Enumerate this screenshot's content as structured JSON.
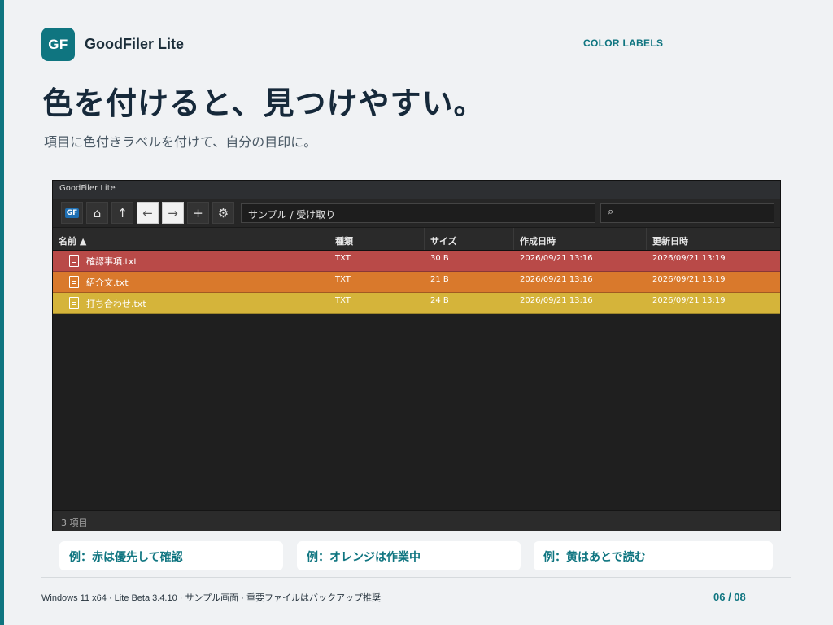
{
  "brand": {
    "logo_text": "GF",
    "name": "GoodFiler Lite"
  },
  "section_tag": "COLOR LABELS",
  "headline": "色を付けると、見つけやすい。",
  "subline": "項目に色付きラベルを付けて、自分の目印に。",
  "app": {
    "title": "GoodFiler Lite",
    "toolbar": {
      "logo_label": "GF",
      "home_glyph": "⌂",
      "up_glyph": "↑",
      "back_glyph": "←",
      "forward_glyph": "→",
      "add_glyph": "+",
      "settings_glyph": "⚙",
      "path": "サンプル / 受け取り",
      "search_glyph": "⌕"
    },
    "columns": [
      "名前 ▲",
      "種類",
      "サイズ",
      "作成日時",
      "更新日時"
    ],
    "rows": [
      {
        "name": "確認事項.txt",
        "type": "TXT",
        "size": "30 B",
        "created": "2026/09/21 13:16",
        "modified": "2026/09/21 13:19",
        "label_color": "#b94a48"
      },
      {
        "name": "紹介文.txt",
        "type": "TXT",
        "size": "21 B",
        "created": "2026/09/21 13:16",
        "modified": "2026/09/21 13:19",
        "label_color": "#d9792c"
      },
      {
        "name": "打ち合わせ.txt",
        "type": "TXT",
        "size": "24 B",
        "created": "2026/09/21 13:16",
        "modified": "2026/09/21 13:19",
        "label_color": "#d5b43a"
      }
    ],
    "status": "3 項目"
  },
  "examples": [
    "例：赤は優先して確認",
    "例：オレンジは作業中",
    "例：黄はあとで読む"
  ],
  "footer": {
    "text": "Windows 11 x64 · Lite Beta 3.4.10 · サンプル画面 · 重要ファイルはバックアップ推奨",
    "page": "06 / 08"
  },
  "colors": {
    "accent": "#0f7580",
    "red_label": "#b94a48",
    "orange_label": "#d9792c",
    "yellow_label": "#d5b43a"
  }
}
